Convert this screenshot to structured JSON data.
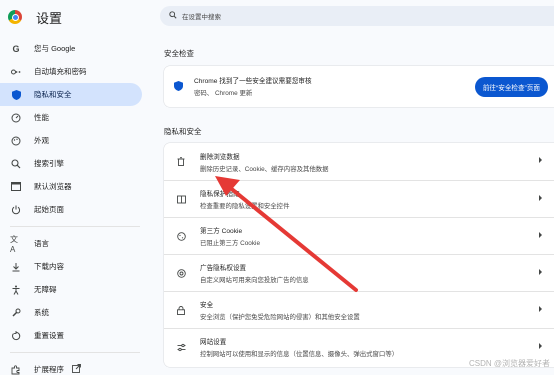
{
  "app": {
    "title": "设置"
  },
  "search": {
    "placeholder": "在设置中搜索"
  },
  "sidebar": {
    "items": [
      {
        "label": "您与 Google",
        "icon": "google-icon"
      },
      {
        "label": "自动填充和密码",
        "icon": "key-icon"
      },
      {
        "label": "隐私和安全",
        "icon": "shield-icon",
        "active": true
      },
      {
        "label": "性能",
        "icon": "speedometer-icon"
      },
      {
        "label": "外观",
        "icon": "palette-icon"
      },
      {
        "label": "搜索引擎",
        "icon": "search-icon"
      },
      {
        "label": "默认浏览器",
        "icon": "browser-icon"
      },
      {
        "label": "起始页面",
        "icon": "power-icon"
      },
      {
        "label": "语言",
        "icon": "translate-icon"
      },
      {
        "label": "下载内容",
        "icon": "download-icon"
      },
      {
        "label": "无障碍",
        "icon": "accessibility-icon"
      },
      {
        "label": "系统",
        "icon": "wrench-icon"
      },
      {
        "label": "重置设置",
        "icon": "reset-icon"
      }
    ],
    "extensions": {
      "label": "扩展程序",
      "icon": "puzzle-icon",
      "link_icon": "external-link-icon"
    }
  },
  "safety_check": {
    "heading": "安全检查",
    "line1": "Chrome 找到了一些安全建议需要您审核",
    "line2": "密码、 Chrome 更新",
    "button": "前往“安全检查”页面"
  },
  "privacy": {
    "heading": "隐私和安全",
    "rows": [
      {
        "title": "删除浏览数据",
        "desc": "删除历史记录、Cookie、缓存内容及其他数据",
        "icon": "trash-icon"
      },
      {
        "title": "隐私保护指南",
        "desc": "检查重要的隐私设置和安全控件",
        "icon": "guide-icon"
      },
      {
        "title": "第三方 Cookie",
        "desc": "已阻止第三方 Cookie",
        "icon": "cookie-icon"
      },
      {
        "title": "广告隐私权设置",
        "desc": "自定义网站可用来向您投放广告的信息",
        "icon": "ad-privacy-icon"
      },
      {
        "title": "安全",
        "desc": "安全浏览（保护您免受危险网站的侵害）和其他安全设置",
        "icon": "lock-icon"
      },
      {
        "title": "网站设置",
        "desc": "控制网站可以使用和显示的信息（位置信息、摄像头、弹出式窗口等）",
        "icon": "sliders-icon"
      }
    ]
  },
  "watermark": "CSDN @浏览器爱好者",
  "colors": {
    "accent": "#0b57d0",
    "active_bg": "#d3e3fd",
    "annotation": "#e53935"
  }
}
